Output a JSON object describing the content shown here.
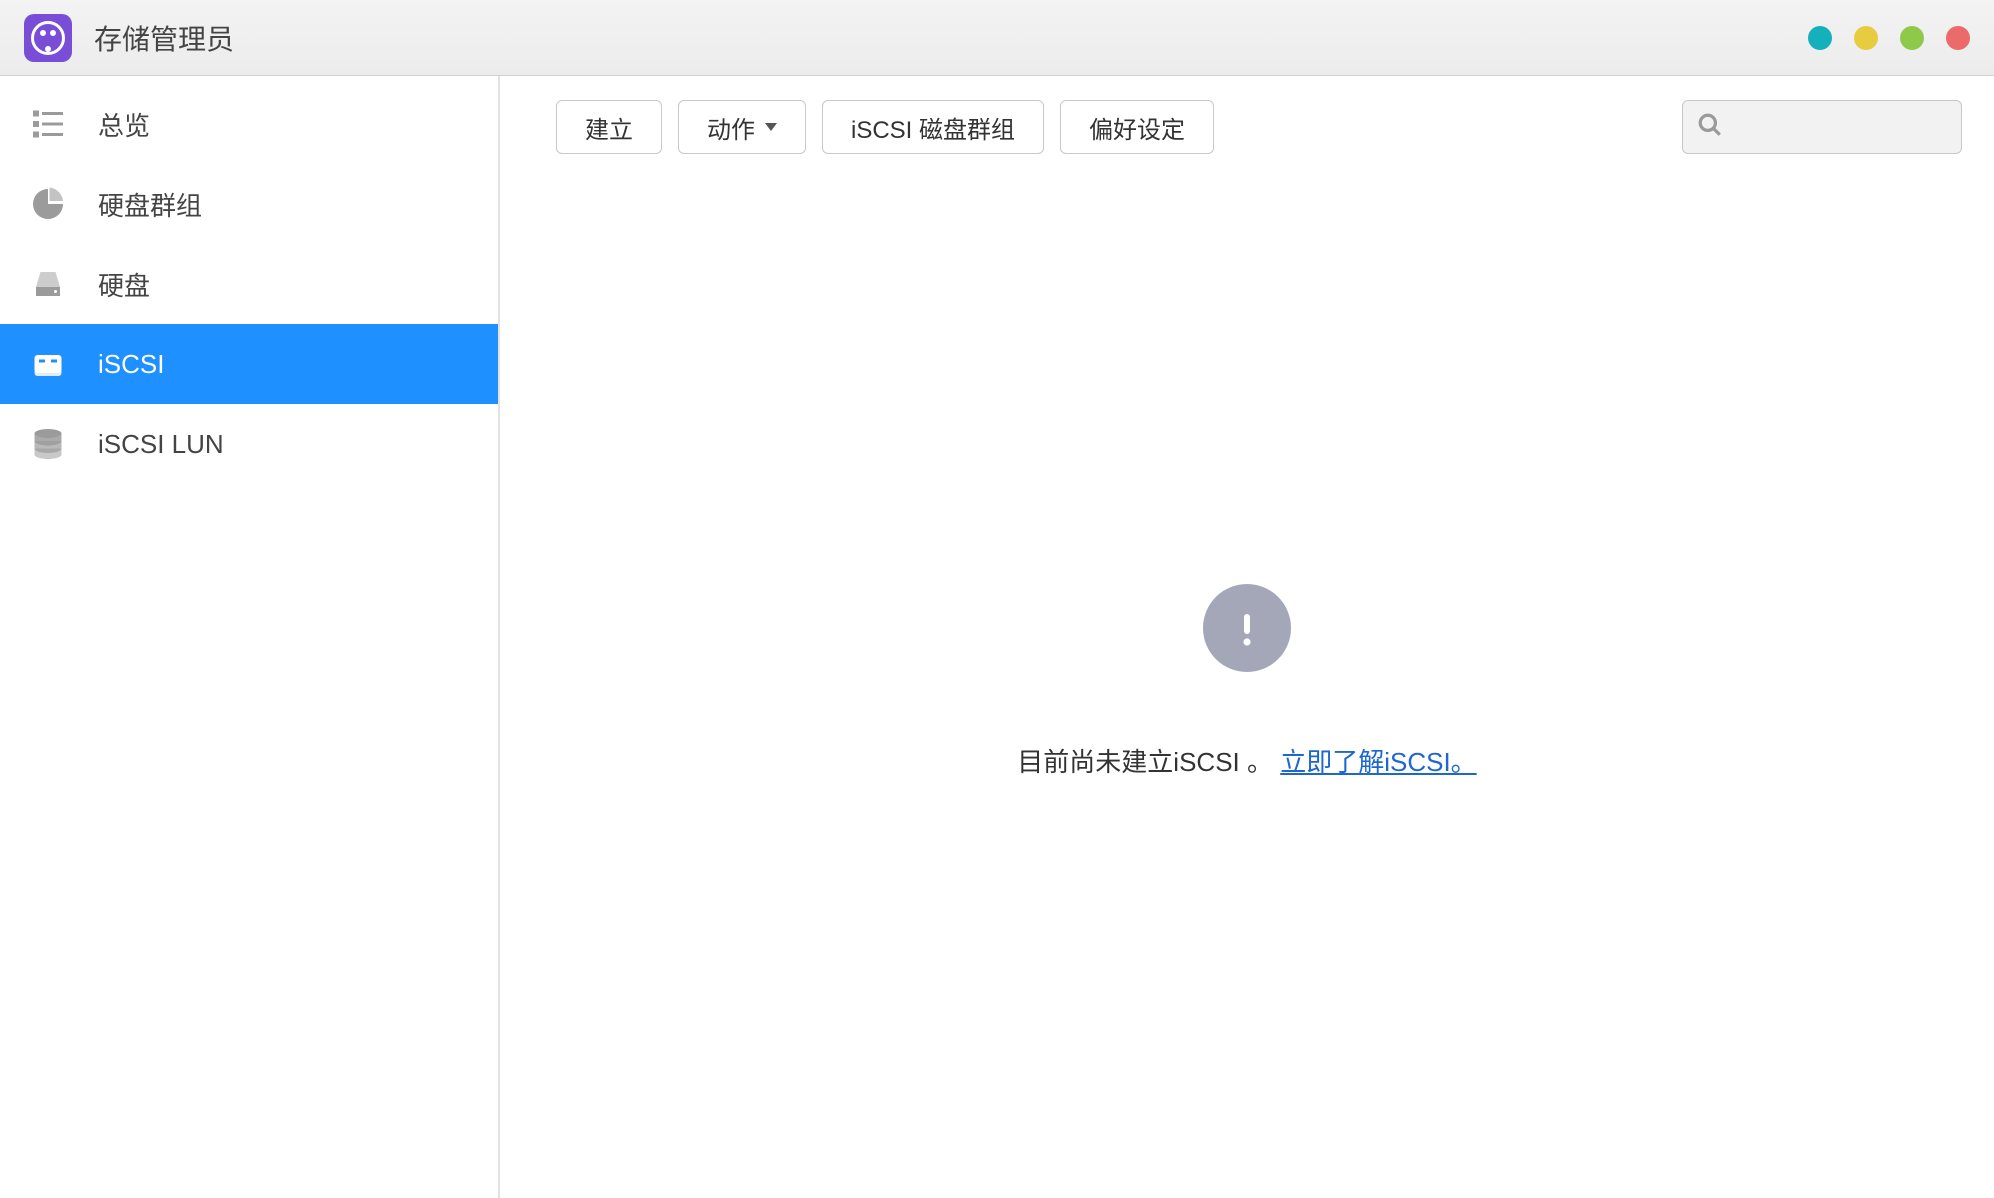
{
  "header": {
    "title": "存储管理员"
  },
  "sidebar": {
    "items": [
      {
        "label": "总览"
      },
      {
        "label": "硬盘群组"
      },
      {
        "label": "硬盘"
      },
      {
        "label": "iSCSI"
      },
      {
        "label": "iSCSI LUN"
      }
    ],
    "active_index": 3
  },
  "toolbar": {
    "create_label": "建立",
    "action_label": "动作",
    "iscsi_group_label": "iSCSI 磁盘群组",
    "prefs_label": "偏好设定",
    "search_placeholder": ""
  },
  "empty_state": {
    "message": "目前尚未建立iSCSI 。 ",
    "link_text": "立即了解iSCSI。"
  }
}
